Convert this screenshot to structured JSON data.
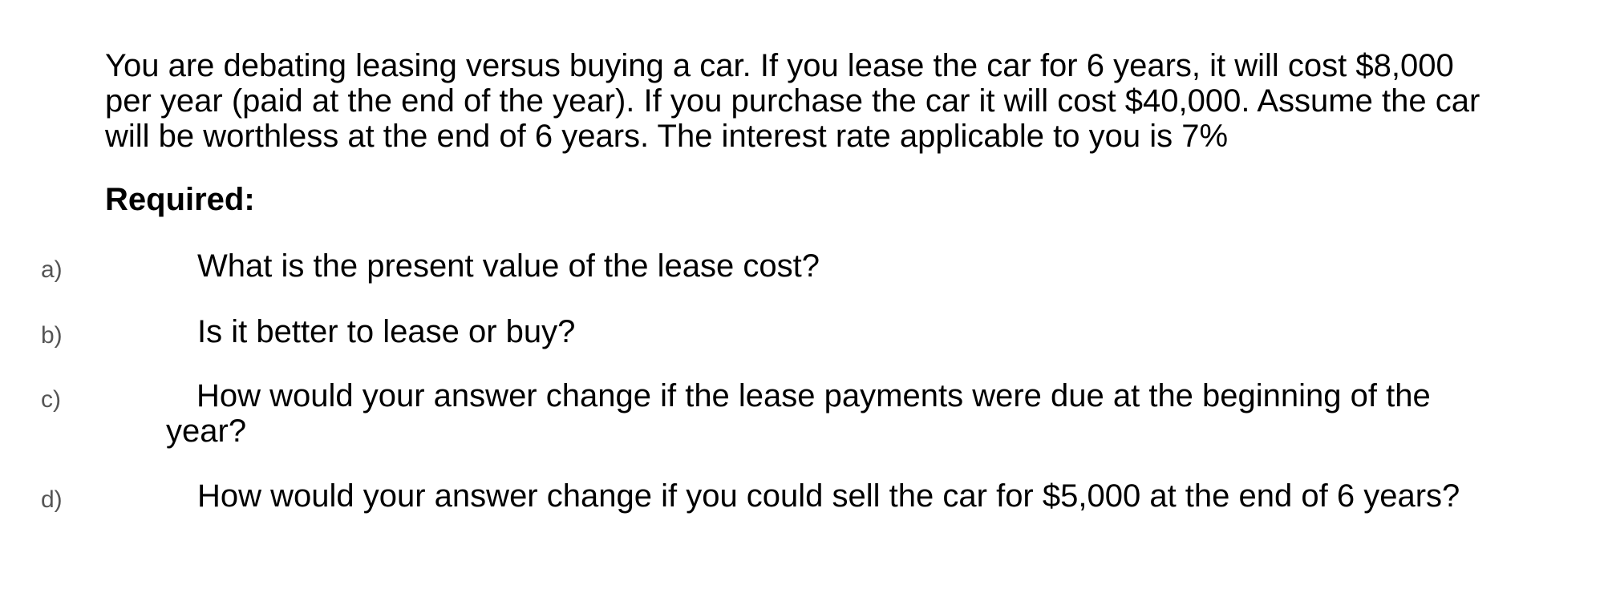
{
  "intro": {
    "lines": [
      "You are debating leasing versus buying a car. If you lease the car for 6 years, it will cost $8,000",
      "per year (paid at the end of the year). If you purchase the car it will cost $40,000. Assume the car",
      "will be worthless at the end of 6 years. The interest rate applicable to you is 7%"
    ]
  },
  "required_heading": "Required:",
  "questions": [
    {
      "letter": "a)",
      "lines": [
        "What is the present value of the lease cost?"
      ]
    },
    {
      "letter": "b)",
      "lines": [
        "Is it better to lease or buy?"
      ]
    },
    {
      "letter": "c)",
      "lines": [
        "How would your answer change if the lease payments were due at the beginning of the",
        "year?"
      ]
    },
    {
      "letter": "d)",
      "lines": [
        "How would your answer change if you could sell the car for $5,000 at the end of 6 years?"
      ]
    }
  ]
}
